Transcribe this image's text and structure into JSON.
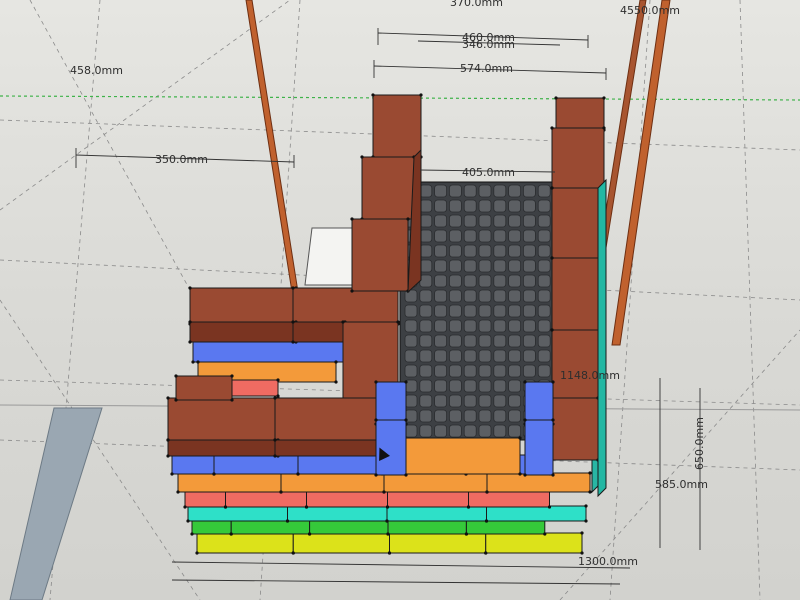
{
  "app": {
    "view": "SketchUp 3D model viewport"
  },
  "dimensions": {
    "d370": "370.0mm",
    "d4550": "4550.0mm",
    "d460": "460.0mm",
    "d346": "346.0mm",
    "d458": "458.0mm",
    "d574": "574.0mm",
    "d350": "350.0mm",
    "d405": "405.0mm",
    "d1148": "1148.0mm",
    "d650": "650.0mm",
    "d585": "585.0mm",
    "d1300": "1300.0mm"
  },
  "colors": {
    "brick": "#9a4a32",
    "brick_dark": "#7a3421",
    "blue": "#5a78f0",
    "orange": "#f39a3a",
    "red": "#ef6b62",
    "cyan": "#2ee0c8",
    "green": "#35c93a",
    "yellow": "#dce21a",
    "grate": "#5c5f63",
    "guide_green": "#3fb24a",
    "pipe": "#c0612e",
    "column": "#9aa7b2"
  }
}
